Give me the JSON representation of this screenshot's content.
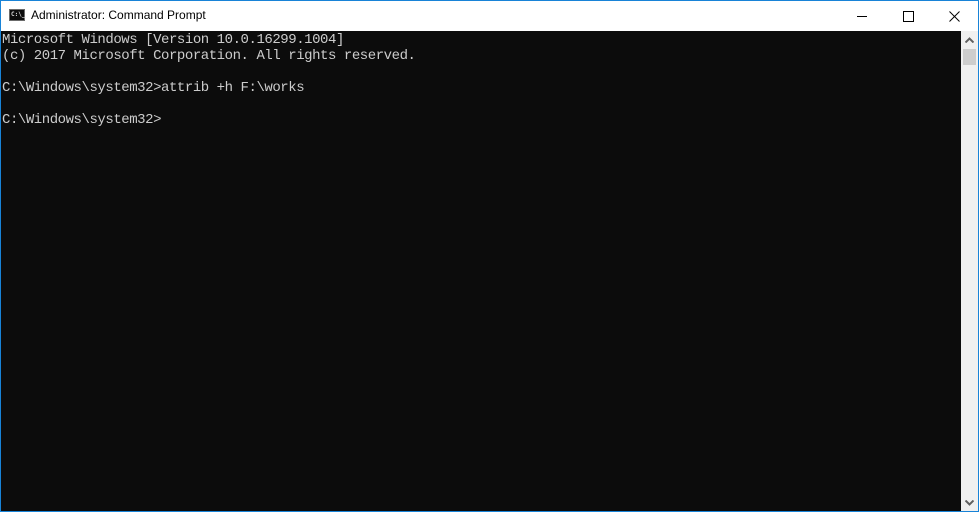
{
  "window": {
    "title": "Administrator: Command Prompt",
    "app_icon_label": "C:\\_",
    "border_color": "#1883d7"
  },
  "controls": {
    "minimize": "minimize",
    "maximize": "maximize",
    "close": "✕"
  },
  "console": {
    "background": "#0c0c0c",
    "foreground": "#cccccc",
    "lines": [
      "Microsoft Windows [Version 10.0.16299.1004]",
      "(c) 2017 Microsoft Corporation. All rights reserved.",
      "",
      "C:\\Windows\\system32>attrib +h F:\\works",
      "",
      "C:\\Windows\\system32>"
    ]
  },
  "scrollbar": {
    "up_arrow": "⌃",
    "down_arrow": "⌄"
  }
}
